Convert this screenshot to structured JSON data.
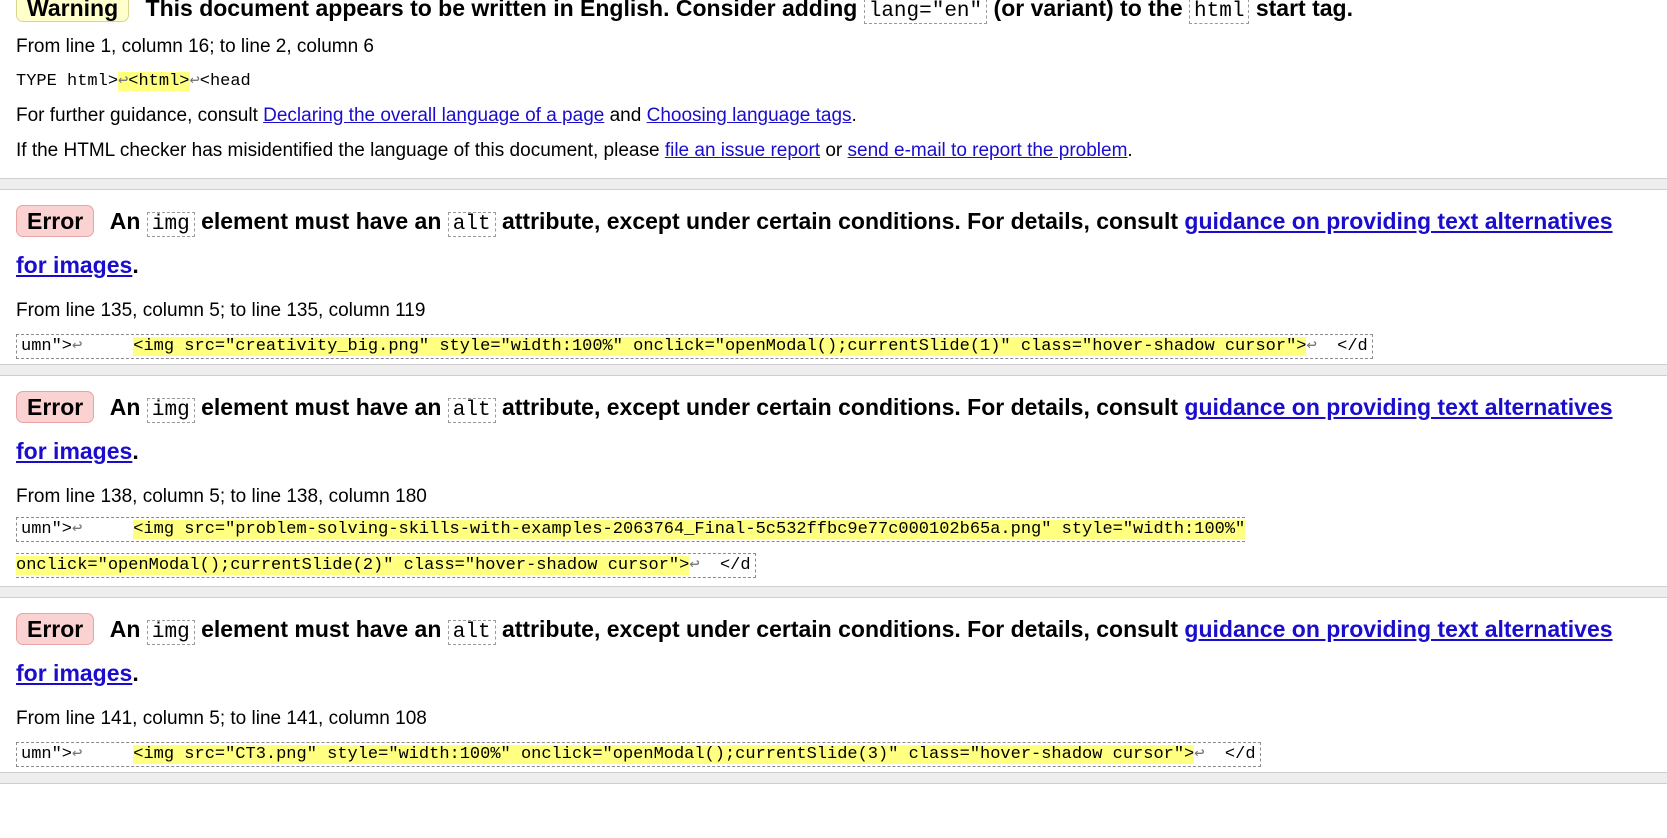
{
  "warning": {
    "badge": "Warning",
    "text_before": "This document appears to be written in English. Consider adding",
    "code_lang": "lang=\"en\"",
    "text_mid": "(or variant) to the",
    "code_html": "html",
    "text_after": "start tag.",
    "location": "From line 1, column 16; to line 2, column 6",
    "extract_pre": "TYPE html>",
    "extract_lf": "↩",
    "extract_hl": "<html>",
    "extract_post": "<head",
    "guidance_pre": "For further guidance, consult",
    "guidance_link1": "Declaring the overall language of a page",
    "guidance_and": "and",
    "guidance_link2": "Choosing language tags",
    "guidance_end": ".",
    "misid_pre": "If the HTML checker has misidentified the language of this document, please",
    "misid_link1": "file an issue report",
    "misid_or": "or",
    "misid_link2": "send e-mail to report the problem",
    "misid_end": "."
  },
  "errors": [
    {
      "badge": "Error",
      "text_an": "An",
      "code_img": "img",
      "text_mid": "element must have an",
      "code_alt": "alt",
      "text_after": "attribute, except under certain conditions. For details, consult",
      "link": "guidance on providing text alternatives for images",
      "end": ".",
      "location": "From line 135, column 5; to line 135, column 119",
      "extract_pre": "umn\">",
      "extract_hl": "<img src=\"creativity_big.png\" style=\"width:100%\" onclick=\"openModal();currentSlide(1)\" class=\"hover-shadow cursor\">",
      "extract_post": "</d"
    },
    {
      "badge": "Error",
      "text_an": "An",
      "code_img": "img",
      "text_mid": "element must have an",
      "code_alt": "alt",
      "text_after": "attribute, except under certain conditions. For details, consult",
      "link": "guidance on providing text alternatives for images",
      "end": ".",
      "location": "From line 138, column 5; to line 138, column 180",
      "extract_pre": "umn\">",
      "extract_hl": "<img src=\"problem-solving-skills-with-examples-2063764_Final-5c532ffbc9e77c000102b65a.png\" style=\"width:100%\" onclick=\"openModal();currentSlide(2)\" class=\"hover-shadow cursor\">",
      "extract_post": "</d"
    },
    {
      "badge": "Error",
      "text_an": "An",
      "code_img": "img",
      "text_mid": "element must have an",
      "code_alt": "alt",
      "text_after": "attribute, except under certain conditions. For details, consult",
      "link": "guidance on providing text alternatives for images",
      "end": ".",
      "location": "From line 141, column 5; to line 141, column 108",
      "extract_pre": "umn\">",
      "extract_hl": "<img src=\"CT3.png\" style=\"width:100%\" onclick=\"openModal();currentSlide(3)\" class=\"hover-shadow cursor\">",
      "extract_post": "</d"
    }
  ],
  "colors": {
    "error_badge_bg": "#fbd2d2",
    "warning_badge_bg": "#ffffcc",
    "highlight": "#ffff80",
    "link": "#1a0dcc",
    "separator": "#eeeeee"
  }
}
